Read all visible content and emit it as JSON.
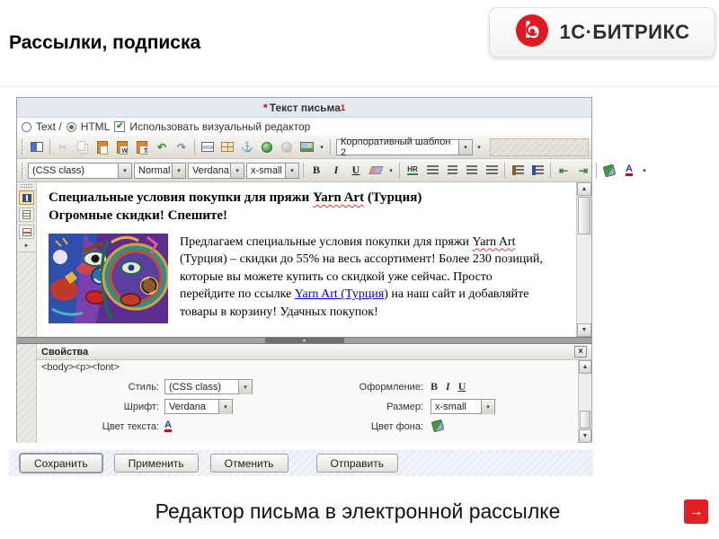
{
  "slide": {
    "title": "Рассылки, подписка",
    "caption": "Редактор письма в электронной рассылке"
  },
  "logo": {
    "text": "1С·БИТРИКС",
    "brand_red": "#e01a22"
  },
  "colors": {
    "header_bar_bg": "#e4e8f1",
    "accent_red": "#cc0000",
    "link_blue": "#0000cc",
    "selected_tool_border": "#d98b2a",
    "next_arrow_red": "#e31e24"
  },
  "editor": {
    "header": {
      "required_mark": "*",
      "title": "Текст письма",
      "footnote": "1"
    },
    "mode_bar": {
      "text_option": "Text /",
      "html_option": "HTML",
      "visual_editor_checkbox": "Использовать визуальный редактор"
    },
    "toolbar_top": {
      "template_select": "Корпоративный шаблон 2"
    },
    "toolbar_format": {
      "css_class_select": "(CSS class)",
      "paragraph_select": "Normal",
      "font_select": "Verdana",
      "size_select": "x-small",
      "bold": "B",
      "italic": "I",
      "underline": "U",
      "hr": "HR"
    },
    "content": {
      "heading_before": "Специальные условия покупки для пряжи ",
      "heading_misspelled": "Yarn Art",
      "heading_after": " (Турция)",
      "heading_line2": "Огромные скидки! Спешите!",
      "body_before": "Предлагаем специальные условия покупки для пряжи ",
      "body_misspelled": "Yarn Art",
      "body_mid": " (Турция) – скидки до 55% на весь ассортимент! Более 230 позиций, которые вы можете купить со скидкой уже сейчас. Просто перейдите по ссылке ",
      "body_link": "Yarn Art (Турция",
      "body_after": ") на наш сайт и добавляйте товары в корзину! Удачных покупок!"
    },
    "properties": {
      "title": "Свойства",
      "close": "×",
      "breadcrumb": "<body><p><font>",
      "style_label": "Стиль:",
      "style_value": "(CSS class)",
      "font_label": "Шрифт:",
      "font_value": "Verdana",
      "text_color_label": "Цвет текста:",
      "decoration_label": "Оформление:",
      "decoration_bold": "B",
      "decoration_italic": "I",
      "decoration_underline": "U",
      "size_label": "Размер:",
      "size_value": "x-small",
      "bg_color_label": "Цвет фона:",
      "font_color_glyph": "A"
    },
    "footer_buttons": [
      "Сохранить",
      "Применить",
      "Отменить",
      "Отправить"
    ]
  },
  "icons": {
    "check": "✔",
    "cut": "✂",
    "undo": "↶",
    "redo": "↷",
    "anchor": "⚓",
    "dropdown": "▾",
    "expander": "▸",
    "scroll_up": "▲",
    "scroll_down": "▼",
    "splitter_handle": "▾",
    "next_arrow": "→",
    "paste_word_letter": "W",
    "paste_text_letter": "T",
    "outdent": "⇤",
    "indent": "⇥"
  }
}
